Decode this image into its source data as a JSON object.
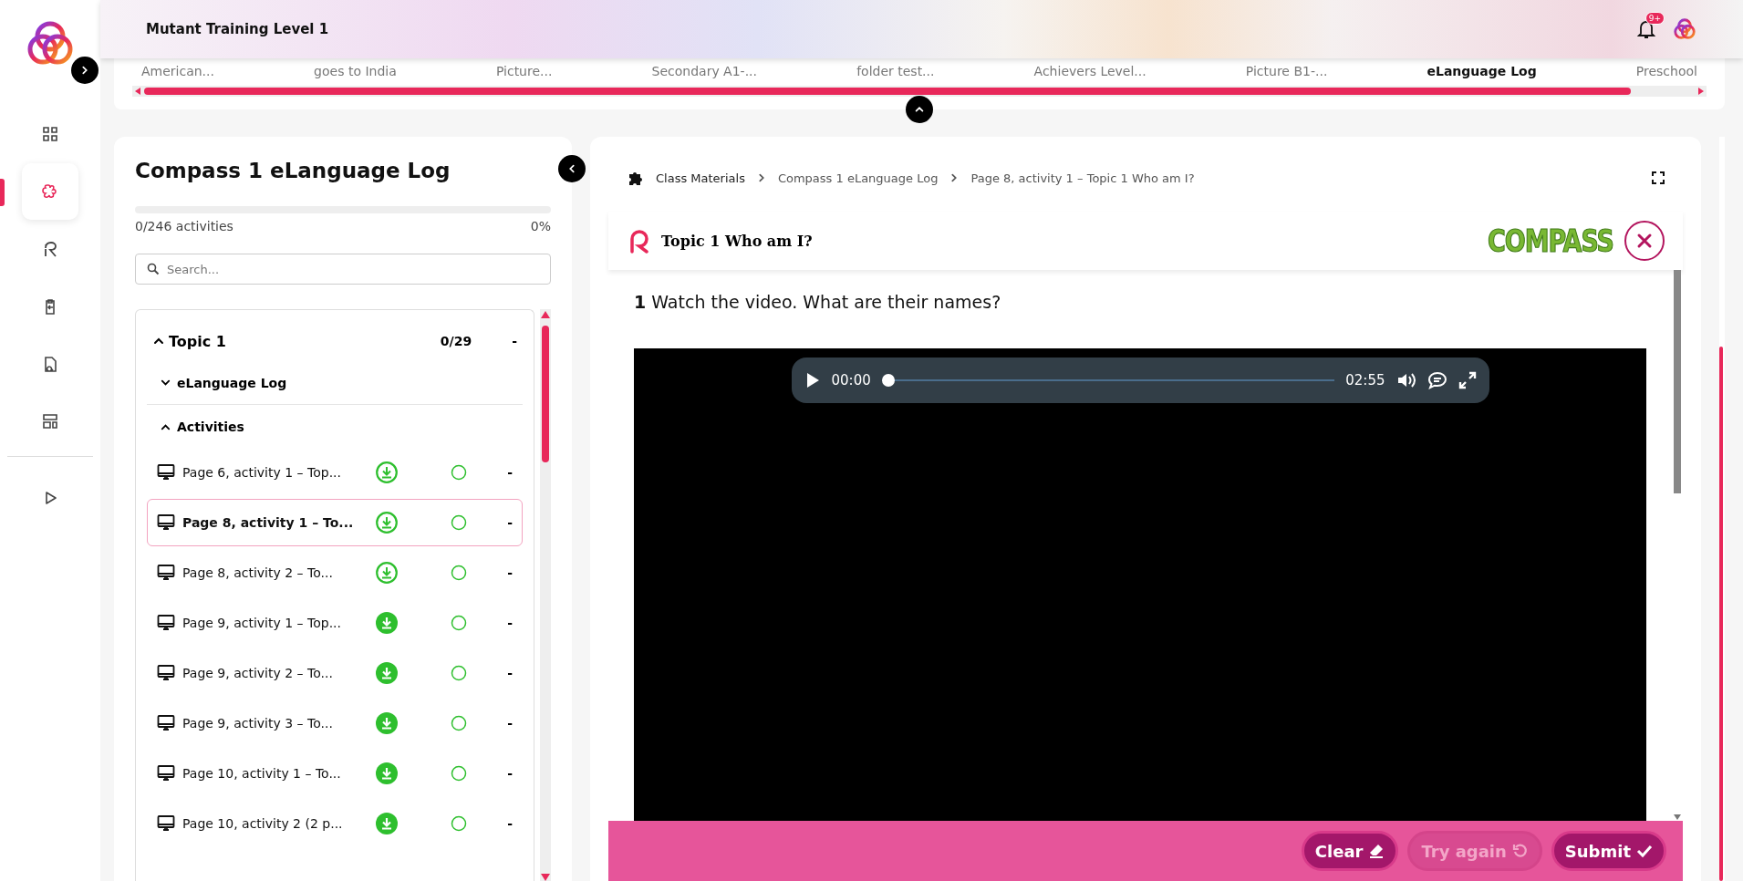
{
  "header": {
    "title": "Mutant Training Level 1",
    "badge": "9+"
  },
  "sidebar": {
    "items": [
      {
        "selected": false
      },
      {
        "selected": true
      },
      {
        "selected": false
      },
      {
        "selected": false
      },
      {
        "selected": false
      },
      {
        "selected": false
      },
      {
        "selected": false
      }
    ]
  },
  "course_tabs": [
    {
      "label": "American...",
      "selected": false
    },
    {
      "label": "goes to India",
      "selected": false
    },
    {
      "label": "Picture...",
      "selected": false
    },
    {
      "label": "Secondary A1-...",
      "selected": false
    },
    {
      "label": "folder test...",
      "selected": false
    },
    {
      "label": "Achievers Level...",
      "selected": false
    },
    {
      "label": "Picture B1-...",
      "selected": false
    },
    {
      "label": "eLanguage Log",
      "selected": true
    },
    {
      "label": "Preschool",
      "selected": false
    }
  ],
  "outline": {
    "title": "Compass 1 eLanguage Log",
    "progress": {
      "level": 0,
      "count": "0/246 activities",
      "percent": "0%"
    },
    "search": {
      "placeholder": "Search..."
    },
    "topic": {
      "label": "Topic 1",
      "count": "0/29",
      "score": "-",
      "expanded": true,
      "children": [
        {
          "label": "eLanguage Log",
          "expanded": false
        },
        {
          "label": "Activities",
          "expanded": true,
          "children": [
            {
              "label": "Page 6, activity 1 – Top...",
              "kind": "outlined",
              "selected": false,
              "score": "-"
            },
            {
              "label": "Page 8, activity 1 – To...",
              "kind": "outlined",
              "selected": true,
              "score": "-"
            },
            {
              "label": "Page 8, activity 2 – To...",
              "kind": "outlined",
              "selected": false,
              "score": "-"
            },
            {
              "label": "Page 9, activity 1 – Top...",
              "kind": "filled",
              "selected": false,
              "score": "-"
            },
            {
              "label": "Page 9, activity 2 – To...",
              "kind": "filled",
              "selected": false,
              "score": "-"
            },
            {
              "label": "Page 9, activity 3 – To...",
              "kind": "filled",
              "selected": false,
              "score": "-"
            },
            {
              "label": "Page 10, activity 1 – To...",
              "kind": "filled",
              "selected": false,
              "score": "-"
            },
            {
              "label": "Page 10, activity 2 (2 p...",
              "kind": "filled",
              "selected": false,
              "score": "-"
            }
          ]
        }
      ]
    }
  },
  "breadcrumb": [
    "Class Materials",
    "Compass 1 eLanguage Log",
    "Page 8, activity 1 – Topic 1 Who am I?"
  ],
  "activity": {
    "title": "Topic 1 Who am I?",
    "logo": "COMPASS",
    "question": "**1** Watch the video. What are their names?",
    "player": {
      "current": "00:00",
      "duration": "02:55",
      "level": 0
    },
    "buttons": [
      {
        "label": "Clear",
        "kind": "clear",
        "disabled": false
      },
      {
        "label": "Try again",
        "kind": "retry",
        "disabled": true
      },
      {
        "label": "Submit",
        "kind": "submit",
        "disabled": false
      }
    ]
  }
}
